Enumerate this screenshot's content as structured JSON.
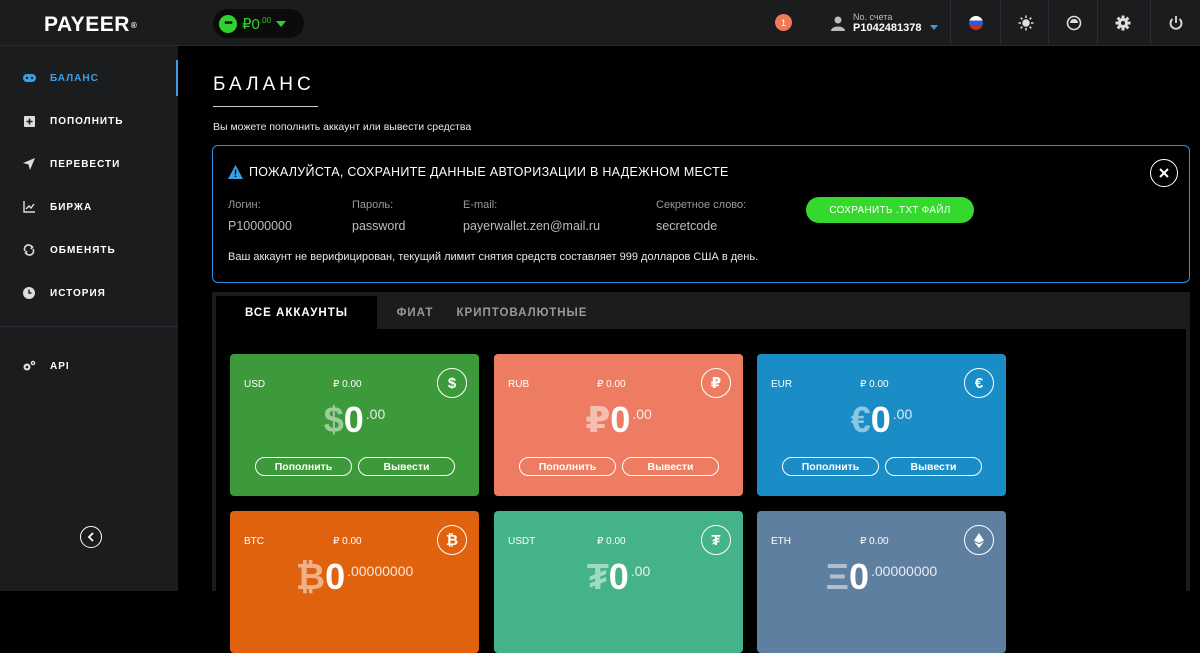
{
  "app": {
    "logo_main": "PAYEER",
    "logo_reg": "®"
  },
  "topbar": {
    "wallet_icon": "dots-icon",
    "wallet_amount": "₽0",
    "wallet_decimals": ".00",
    "notification_count": "1",
    "account_label": "No. счета",
    "account_number": "P1042481378",
    "icons": [
      "russia-flag-icon",
      "sun-icon",
      "support-icon",
      "gear-icon",
      "power-icon"
    ]
  },
  "sidebar": {
    "items": [
      {
        "label": "БАЛАНС",
        "icon": "gamepad-icon",
        "active": true
      },
      {
        "label": "ПОПОЛНИТЬ",
        "icon": "plus-square-icon",
        "active": false
      },
      {
        "label": "ПЕРЕВЕСТИ",
        "icon": "paper-plane-icon",
        "active": false
      },
      {
        "label": "БИРЖА",
        "icon": "chart-icon",
        "active": false
      },
      {
        "label": "ОБМЕНЯТЬ",
        "icon": "exchange-icon",
        "active": false
      },
      {
        "label": "ИСТОРИЯ",
        "icon": "clock-icon",
        "active": false
      },
      {
        "label": "API",
        "icon": "gears-icon",
        "active": false
      }
    ]
  },
  "main": {
    "title": "БАЛАНС",
    "subtitle": "Вы можете пополнить аккаунт или вывести средства",
    "alert": {
      "heading": "ПОЖАЛУЙСТА, СОХРАНИТЕ ДАННЫЕ АВТОРИЗАЦИИ В НАДЕЖНОМ МЕСТЕ",
      "login_label": "Логин:",
      "login_value": "P10000000",
      "password_label": "Пароль:",
      "password_value": "password",
      "email_label": "E-mail:",
      "email_value": "payerwallet.zen@mail.ru",
      "secret_label": "Секретное слово:",
      "secret_value": "secretcode",
      "save_button": "СОХРАНИТЬ .TXT ФАЙЛ",
      "note": "Ваш аккаунт не верифицирован, текущий лимит снятия средств составляет 999 долларов США в день."
    },
    "tabs": [
      {
        "label": "ВСЕ АККАУНТЫ",
        "active": true
      },
      {
        "label": "ФИАТ",
        "active": false
      },
      {
        "label": "КРИПТОВАЛЮТНЫЕ",
        "active": false
      }
    ],
    "cards": [
      {
        "code": "USD",
        "rub": "₽ 0.00",
        "symbol": "$",
        "int": "0",
        "dec": ".00",
        "icon": "dollar-icon",
        "color": "#3d9a3a",
        "btn1": "Пополнить",
        "btn2": "Вывести"
      },
      {
        "code": "RUB",
        "rub": "₽ 0.00",
        "symbol": "₽",
        "int": "0",
        "dec": ".00",
        "icon": "ruble-icon",
        "color": "#ee7c63",
        "btn1": "Пополнить",
        "btn2": "Вывести"
      },
      {
        "code": "EUR",
        "rub": "₽ 0.00",
        "symbol": "€",
        "int": "0",
        "dec": ".00",
        "icon": "euro-icon",
        "color": "#1a8dc6",
        "btn1": "Пополнить",
        "btn2": "Вывести"
      },
      {
        "code": "BTC",
        "rub": "₽ 0.00",
        "symbol": "₿",
        "int": "0",
        "dec": ".00000000",
        "icon": "bitcoin-icon",
        "color": "#e0620f"
      },
      {
        "code": "USDT",
        "rub": "₽ 0.00",
        "symbol": "₮",
        "int": "0",
        "dec": ".00",
        "icon": "tether-icon",
        "color": "#45b38a"
      },
      {
        "code": "ETH",
        "rub": "₽ 0.00",
        "symbol": "Ξ",
        "int": "0",
        "dec": ".00000000",
        "icon": "ethereum-icon",
        "color": "#5f7fa0"
      }
    ]
  },
  "colors": {
    "accent": "#3aa0e6",
    "green": "#35d82c",
    "panel": "#1b1c1e"
  }
}
